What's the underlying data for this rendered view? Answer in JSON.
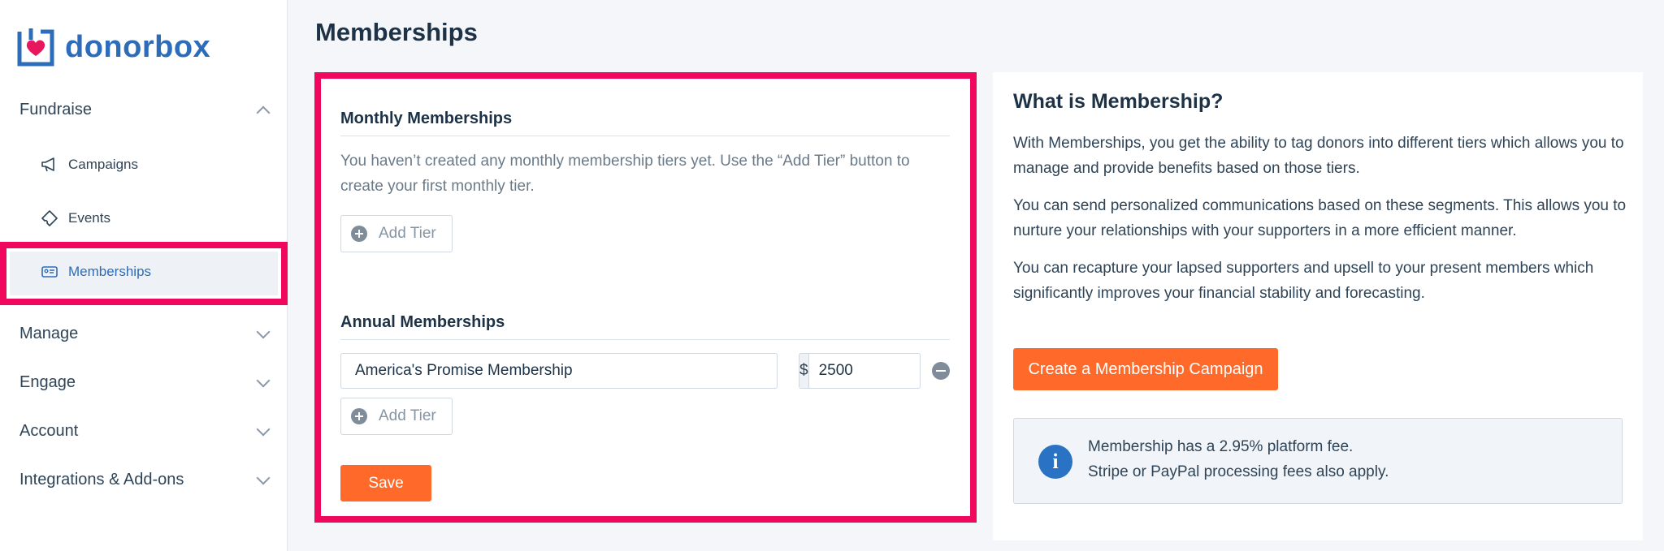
{
  "brand": {
    "name": "donorbox",
    "accent": "#2c6cb8",
    "heart": "#e8175d"
  },
  "sidebar": {
    "sections": [
      {
        "label": "Fundraise",
        "expanded": true
      },
      {
        "label": "Manage",
        "expanded": false
      },
      {
        "label": "Engage",
        "expanded": false
      },
      {
        "label": "Account",
        "expanded": false
      },
      {
        "label": "Integrations & Add-ons",
        "expanded": false
      }
    ],
    "fundraise_items": [
      {
        "label": "Campaigns",
        "icon": "megaphone-icon"
      },
      {
        "label": "Events",
        "icon": "ticket-icon"
      },
      {
        "label": "Memberships",
        "icon": "membership-card-icon",
        "active": true
      }
    ]
  },
  "page": {
    "title": "Memberships"
  },
  "monthly": {
    "heading": "Monthly Memberships",
    "empty_text": "You haven’t created any monthly membership tiers yet. Use the “Add Tier” button to create your first monthly tier.",
    "add_label": "Add Tier"
  },
  "annual": {
    "heading": "Annual Memberships",
    "tiers": [
      {
        "name": "America's Promise Membership",
        "currency": "$",
        "amount": "2500"
      }
    ],
    "add_label": "Add Tier"
  },
  "actions": {
    "save_label": "Save"
  },
  "info": {
    "title": "What is Membership?",
    "paragraphs": [
      "With Memberships, you get the ability to tag donors into different tiers which allows you to manage and provide benefits based on those tiers.",
      "You can send personalized communications based on these segments. This allows you to nurture your relationships with your supporters in a more efficient manner.",
      "You can recapture your lapsed supporters and upsell to your present members which significantly improves your financial stability and forecasting."
    ],
    "cta_label": "Create a Membership Campaign",
    "fee_line1": "Membership has a 2.95% platform fee.",
    "fee_line2": "Stripe or PayPal processing fees also apply."
  },
  "colors": {
    "highlight": "#f0085e",
    "primary_button": "#ff6a2b",
    "info_icon": "#2a73c4"
  }
}
